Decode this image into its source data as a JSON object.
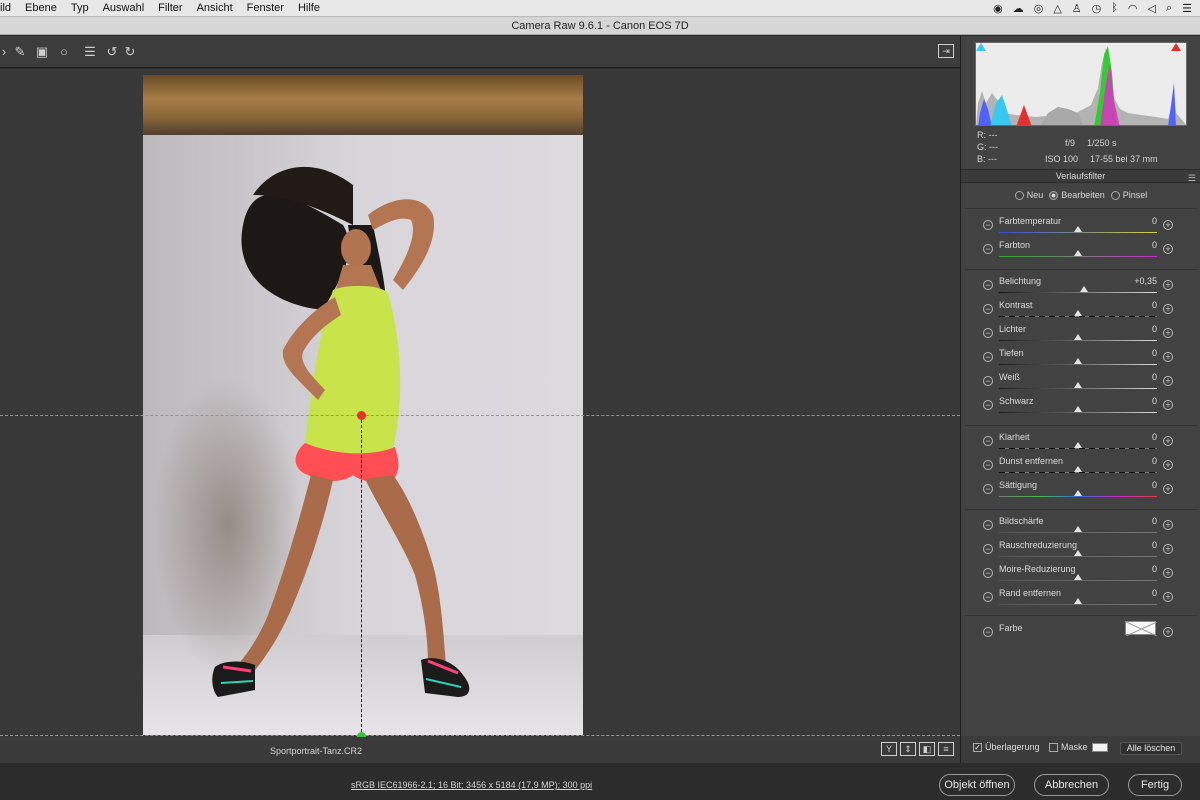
{
  "menubar": {
    "items": [
      "ild",
      "Ebene",
      "Typ",
      "Auswahl",
      "Filter",
      "Ansicht",
      "Fenster",
      "Hilfe"
    ],
    "status_icons": [
      "record-icon",
      "cloud-icon",
      "creative-cloud-icon",
      "drive-icon",
      "person-icon",
      "time-machine-icon",
      "bluetooth-icon",
      "wifi-icon",
      "volume-icon",
      "search-icon",
      "list-icon"
    ]
  },
  "window": {
    "title": "Camera Raw 9.6.1 - Canon EOS 7D"
  },
  "toolbar": {
    "tools": [
      "straighten-icon",
      "brush-icon",
      "graduated-filter-icon",
      "radial-filter-icon",
      "presets-list-icon",
      "rotate-left-icon",
      "rotate-right-icon"
    ],
    "prefs_icon": "preferences-icon"
  },
  "canvas": {
    "filename": "Sportportrait-Tanz.CR2",
    "view_buttons": [
      "Y",
      "⇕",
      "◧",
      "≡"
    ]
  },
  "histogram": {
    "rgb": {
      "r_label": "R:",
      "g_label": "G:",
      "b_label": "B:",
      "r": "---",
      "g": "---",
      "b": "---"
    },
    "exif": {
      "aperture": "f/9",
      "shutter": "1/250 s",
      "iso": "ISO 100",
      "lens": "17-55 bei 37 mm"
    }
  },
  "panel": {
    "title": "Verlaufsfilter",
    "modes": [
      {
        "label": "Neu",
        "selected": false
      },
      {
        "label": "Bearbeiten",
        "selected": true
      },
      {
        "label": "Pinsel",
        "selected": false
      }
    ],
    "sliders": [
      {
        "label": "Farbtemperatur",
        "value": "0",
        "track": "temp",
        "fraction": 0.5
      },
      {
        "label": "Farbton",
        "value": "0",
        "track": "tint",
        "fraction": 0.5
      },
      {
        "label": "Belichtung",
        "value": "+0,35",
        "track": "dark",
        "fraction": 0.54
      },
      {
        "label": "Kontrast",
        "value": "0",
        "track": "dashed",
        "fraction": 0.5
      },
      {
        "label": "Lichter",
        "value": "0",
        "track": "plain",
        "fraction": 0.5
      },
      {
        "label": "Tiefen",
        "value": "0",
        "track": "plain",
        "fraction": 0.5
      },
      {
        "label": "Weiß",
        "value": "0",
        "track": "plain",
        "fraction": 0.5
      },
      {
        "label": "Schwarz",
        "value": "0",
        "track": "plain",
        "fraction": 0.5
      },
      {
        "label": "Klarheit",
        "value": "0",
        "track": "dashed",
        "fraction": 0.5
      },
      {
        "label": "Dunst entfernen",
        "value": "0",
        "track": "dashed",
        "fraction": 0.5
      },
      {
        "label": "Sättigung",
        "value": "0",
        "track": "sat",
        "fraction": 0.5
      },
      {
        "label": "Bildschärfe",
        "value": "0",
        "track": "light",
        "fraction": 0.5
      },
      {
        "label": "Rauschreduzierung",
        "value": "0",
        "track": "light",
        "fraction": 0.5
      },
      {
        "label": "Moire-Reduzierung",
        "value": "0",
        "track": "light",
        "fraction": 0.5
      },
      {
        "label": "Rand entfernen",
        "value": "0",
        "track": "light",
        "fraction": 0.5
      }
    ],
    "color_label": "Farbe",
    "overlay_label": "Überlagerung",
    "overlay_checked": true,
    "mask_label": "Maske",
    "mask_checked": false,
    "clear_all_label": "Alle löschen"
  },
  "footer": {
    "workflow_link": "sRGB IEC61966-2.1; 16 Bit; 3456 x 5184 (17,9 MP); 300 ppi",
    "open_object_label": "Objekt öffnen",
    "cancel_label": "Abbrechen",
    "done_label": "Fertig"
  },
  "colors": {
    "guide_red": "#e27373",
    "guide_green": "#59c859",
    "clip_shadow": "#38c9f0",
    "clip_highlight": "#e2312c"
  }
}
